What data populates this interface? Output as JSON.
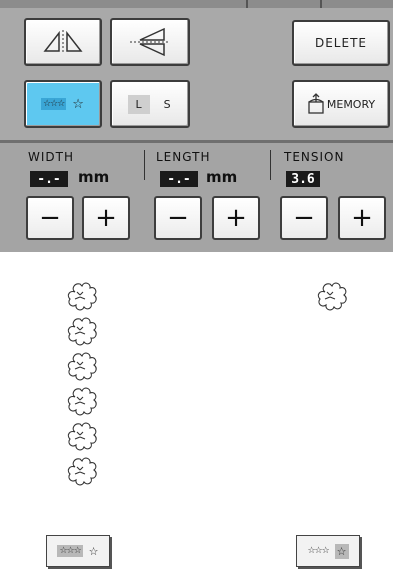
{
  "buttons": {
    "delete_label": "DELETE",
    "memory_label": "MEMORY",
    "size_large_label": "L",
    "size_small_label": "S",
    "repeat_mode_glyph": "☆☆☆ ☆",
    "star_single_glyph": "☆"
  },
  "settings": {
    "width": {
      "label": "WIDTH",
      "value": "-.-",
      "unit": "mm"
    },
    "length": {
      "label": "LENGTH",
      "value": "-.-",
      "unit": "mm"
    },
    "tension": {
      "label": "TENSION",
      "value": "3.6"
    }
  },
  "steppers": {
    "minus": "−",
    "plus": "+"
  },
  "previews": {
    "left_thumb": {
      "multi": "☆☆☆",
      "single": "☆"
    },
    "right_thumb": {
      "multi": "☆☆☆",
      "single": "☆"
    }
  },
  "colors": {
    "selected": "#5ec8f0",
    "panel": "#a9a9a9",
    "value_box": "#1a1a1a"
  }
}
